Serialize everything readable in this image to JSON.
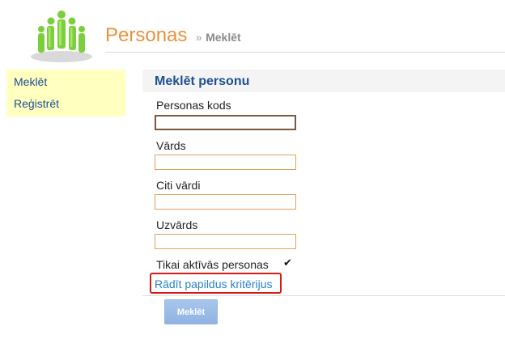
{
  "header": {
    "title": "Personas",
    "separator": "»",
    "subtitle": "Meklēt"
  },
  "sidebar": {
    "items": [
      {
        "label": "Meklēt"
      },
      {
        "label": "Reģistrēt"
      }
    ]
  },
  "main": {
    "panel_title": "Meklēt personu",
    "fields": [
      {
        "label": "Personas kods",
        "value": "",
        "focused": true
      },
      {
        "label": "Vārds",
        "value": ""
      },
      {
        "label": "Citi vārdi",
        "value": ""
      },
      {
        "label": "Uzvārds",
        "value": ""
      }
    ],
    "active_only": {
      "label": "Tikai aktīvās personas",
      "checked": true,
      "glyph": "✔"
    },
    "advanced_link": "Rādīt papildus kritērijus",
    "search_button": "Meklēt"
  },
  "colors": {
    "title": "#e8923c",
    "link": "#1f4f90",
    "sidebar_bg": "#ffffc0",
    "highlight_border": "#d41b1b",
    "advanced_link": "#2b84c4"
  }
}
